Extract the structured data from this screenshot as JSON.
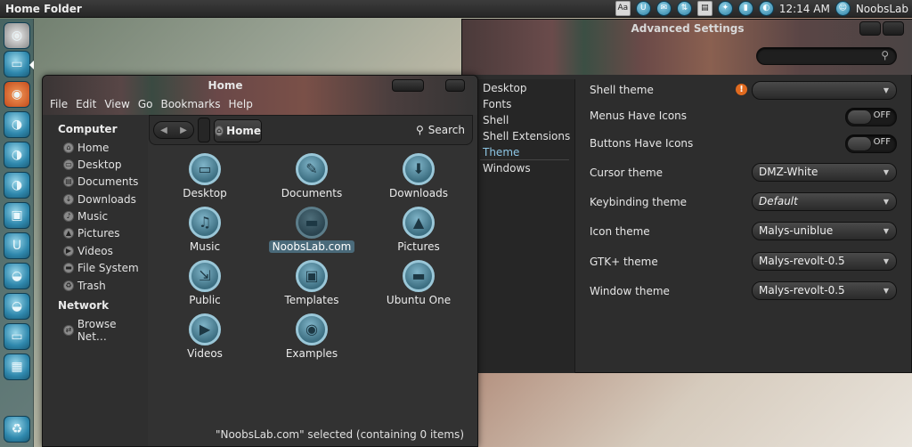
{
  "top_panel": {
    "title": "Home Folder",
    "indicators": [
      "keyboard-indicator-icon",
      "ubuntu-one-icon",
      "mail-icon",
      "network-icon",
      "document-icon",
      "messaging-icon",
      "battery-icon",
      "volume-icon"
    ],
    "keyboard_label": "Aa",
    "clock": "12:14 AM",
    "user": "NoobsLab"
  },
  "launcher": {
    "items": [
      "dash-home",
      "files",
      "firefox",
      "software-center",
      "system-settings",
      "app-1",
      "app-2",
      "app-3",
      "app-4",
      "app-5",
      "app-6",
      "app-7",
      "app-8",
      "workspace-switcher",
      "trash"
    ]
  },
  "advanced_settings": {
    "title": "Advanced Settings",
    "search_placeholder": "",
    "sidebar": [
      "Desktop",
      "Fonts",
      "Shell",
      "Shell Extensions",
      "Theme",
      "Windows"
    ],
    "selected_section": "Theme",
    "rows": {
      "shell_theme_label": "Shell theme",
      "shell_theme_value": "",
      "menus_icons_label": "Menus Have Icons",
      "menus_icons_state": "OFF",
      "buttons_icons_label": "Buttons Have Icons",
      "buttons_icons_state": "OFF",
      "cursor_label": "Cursor theme",
      "cursor_value": "DMZ-White",
      "keybinding_label": "Keybinding theme",
      "keybinding_value": "Default",
      "icon_label": "Icon theme",
      "icon_value": "Malys-uniblue",
      "gtk_label": "GTK+ theme",
      "gtk_value": "Malys-revolt-0.5",
      "window_label": "Window theme",
      "window_value": "Malys-revolt-0.5"
    }
  },
  "file_manager": {
    "title": "Home",
    "menu": [
      "File",
      "Edit",
      "View",
      "Go",
      "Bookmarks",
      "Help"
    ],
    "path_current": "Home",
    "search_label": "Search",
    "sidebar": {
      "computer_heading": "Computer",
      "computer_items": [
        {
          "label": "Home",
          "icon": "home-icon"
        },
        {
          "label": "Desktop",
          "icon": "desktop-icon"
        },
        {
          "label": "Documents",
          "icon": "documents-icon"
        },
        {
          "label": "Downloads",
          "icon": "downloads-icon"
        },
        {
          "label": "Music",
          "icon": "music-icon"
        },
        {
          "label": "Pictures",
          "icon": "pictures-icon"
        },
        {
          "label": "Videos",
          "icon": "videos-icon"
        },
        {
          "label": "File System",
          "icon": "filesystem-icon"
        },
        {
          "label": "Trash",
          "icon": "trash-icon"
        }
      ],
      "network_heading": "Network",
      "network_items": [
        {
          "label": "Browse Net…",
          "icon": "network-icon"
        }
      ]
    },
    "files": [
      {
        "label": "Desktop",
        "icon": "desktop-folder-icon",
        "glyph": "▭"
      },
      {
        "label": "Documents",
        "icon": "documents-folder-icon",
        "glyph": "✎"
      },
      {
        "label": "Downloads",
        "icon": "downloads-folder-icon",
        "glyph": "⬇"
      },
      {
        "label": "Music",
        "icon": "music-folder-icon",
        "glyph": "♫"
      },
      {
        "label": "NoobsLab.com",
        "icon": "folder-icon",
        "glyph": "▬",
        "selected": true
      },
      {
        "label": "Pictures",
        "icon": "pictures-folder-icon",
        "glyph": "▲"
      },
      {
        "label": "Public",
        "icon": "public-folder-icon",
        "glyph": "⇲"
      },
      {
        "label": "Templates",
        "icon": "templates-folder-icon",
        "glyph": "▣"
      },
      {
        "label": "Ubuntu One",
        "icon": "ubuntu-one-folder-icon",
        "glyph": "▬"
      },
      {
        "label": "Videos",
        "icon": "videos-folder-icon",
        "glyph": "▶"
      },
      {
        "label": "Examples",
        "icon": "examples-folder-icon",
        "glyph": "◉"
      }
    ],
    "status": "\"NoobsLab.com\" selected (containing 0 items)"
  }
}
